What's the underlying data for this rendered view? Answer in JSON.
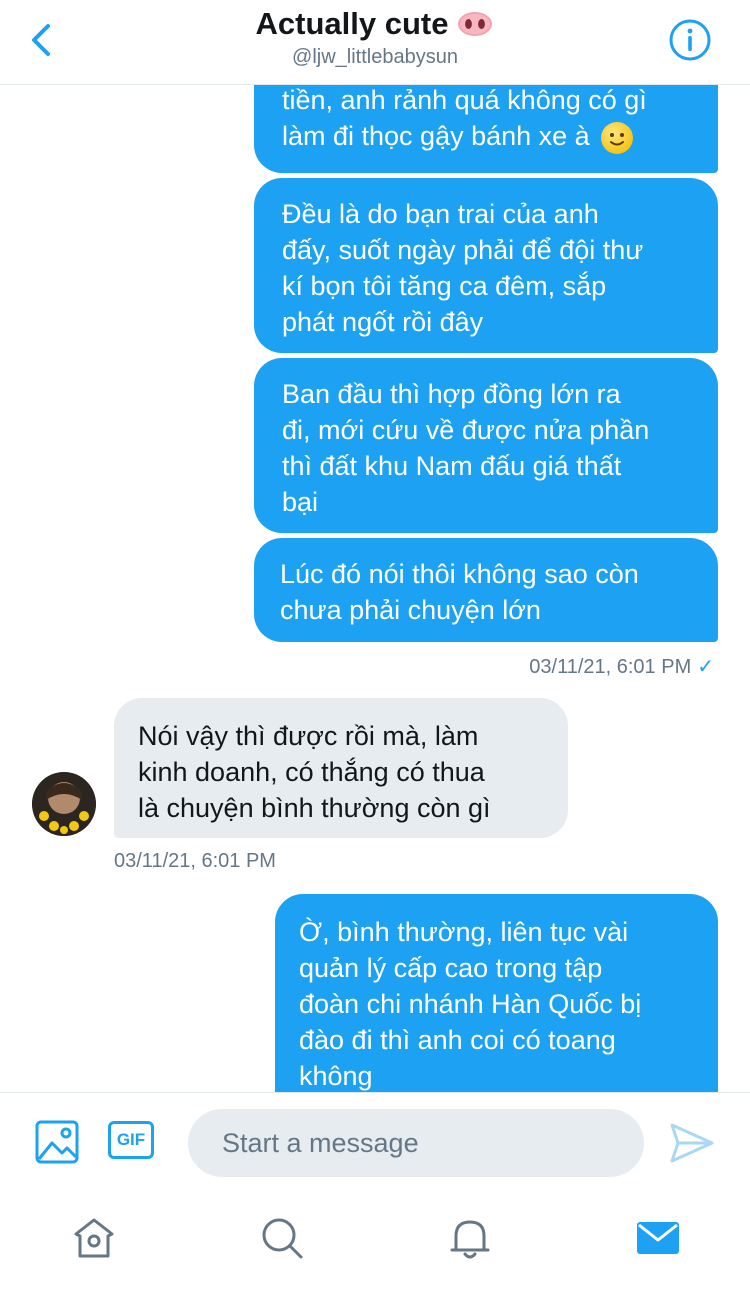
{
  "header": {
    "title": "Actually cute",
    "handle": "@ljw_littlebabysun",
    "title_emoji": "pig-nose-emoji"
  },
  "colors": {
    "accent": "#1da1f2",
    "incoming_bubble": "#e6ecf0",
    "meta_text": "#657786"
  },
  "messages": [
    {
      "direction": "outgoing",
      "lines": [
        "tiền, anh rảnh quá không có gì",
        "làm đi thọc gậy bánh xe à"
      ],
      "emoji": "slightly-smiling-face"
    },
    {
      "direction": "outgoing",
      "lines": [
        "Đều là do bạn trai của anh",
        "đấy, suốt ngày phải để đội thư",
        "kí bọn tôi tăng ca đêm, sắp",
        "phát ngốt rồi đây"
      ]
    },
    {
      "direction": "outgoing",
      "lines": [
        "Ban đầu thì hợp đồng lớn ra",
        "đi, mới cứu về được nửa phần",
        "thì đất khu Nam đấu giá thất",
        "bại"
      ]
    },
    {
      "direction": "outgoing",
      "lines": [
        "Lúc đó nói thôi không sao còn",
        "chưa phải chuyện lớn"
      ]
    },
    {
      "direction": "incoming",
      "lines": [
        "Nói vậy thì được rồi mà, làm",
        "kinh doanh, có thắng có thua",
        "là chuyện bình thường còn gì"
      ]
    },
    {
      "direction": "outgoing",
      "lines": [
        "Ờ, bình thường, liên tục vài",
        "quản lý cấp cao trong tập",
        "đoàn chi nhánh Hàn Quốc bị",
        "đào đi thì anh coi có toang",
        "không"
      ]
    }
  ],
  "timestamps": {
    "outgoing": "03/11/21, 6:01 PM",
    "outgoing_status": "✓",
    "incoming": "03/11/21, 6:01 PM"
  },
  "composer": {
    "placeholder": "Start a message",
    "gif_label": "GIF",
    "icons": [
      "image-icon",
      "gif-icon",
      "send-icon"
    ]
  },
  "tabbar": {
    "icons": [
      "home-icon",
      "search-icon",
      "notifications-icon",
      "messages-icon"
    ],
    "active": "messages-icon"
  }
}
